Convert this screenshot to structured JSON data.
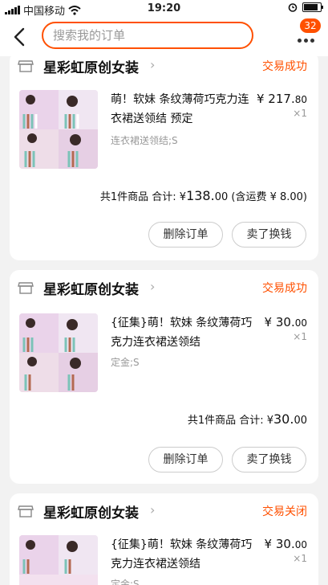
{
  "statusbar": {
    "carrier": "中国移动",
    "time": "19:20"
  },
  "header": {
    "search_placeholder": "搜索我的订单",
    "badge_count": "32"
  },
  "orders": [
    {
      "shop": "星彩虹原创女装",
      "status": "交易成功",
      "title": "萌！软妹 条纹薄荷巧克力连衣裙送领结 预定",
      "sku": "连衣裙送领结;S",
      "price_int": "¥ 217.",
      "price_dec": "80",
      "qty": "×1",
      "summary_prefix": "共1件商品 合计: ¥",
      "total_int": "138.",
      "total_dec": "00",
      "shipping": "(含运费 ¥ 8.00)",
      "btn_left": "删除订单",
      "btn_right": "卖了换钱"
    },
    {
      "shop": "星彩虹原创女装",
      "status": "交易成功",
      "title": "{征集}萌！软妹 条纹薄荷巧克力连衣裙送领结",
      "sku": "定金;S",
      "price_int": "¥ 30.",
      "price_dec": "00",
      "qty": "×1",
      "summary_prefix": "共1件商品 合计: ¥",
      "total_int": "30.",
      "total_dec": "00",
      "btn_left": "删除订单",
      "btn_right": "卖了换钱"
    },
    {
      "shop": "星彩虹原创女装",
      "status": "交易关闭",
      "title": "{征集}萌！软妹 条纹薄荷巧克力连衣裙送领结",
      "sku": "定金;S",
      "price_int": "¥ 30.",
      "price_dec": "00",
      "qty": "×1"
    }
  ],
  "colors": {
    "accent": "#ff5000",
    "background": "#f2f2f2"
  }
}
